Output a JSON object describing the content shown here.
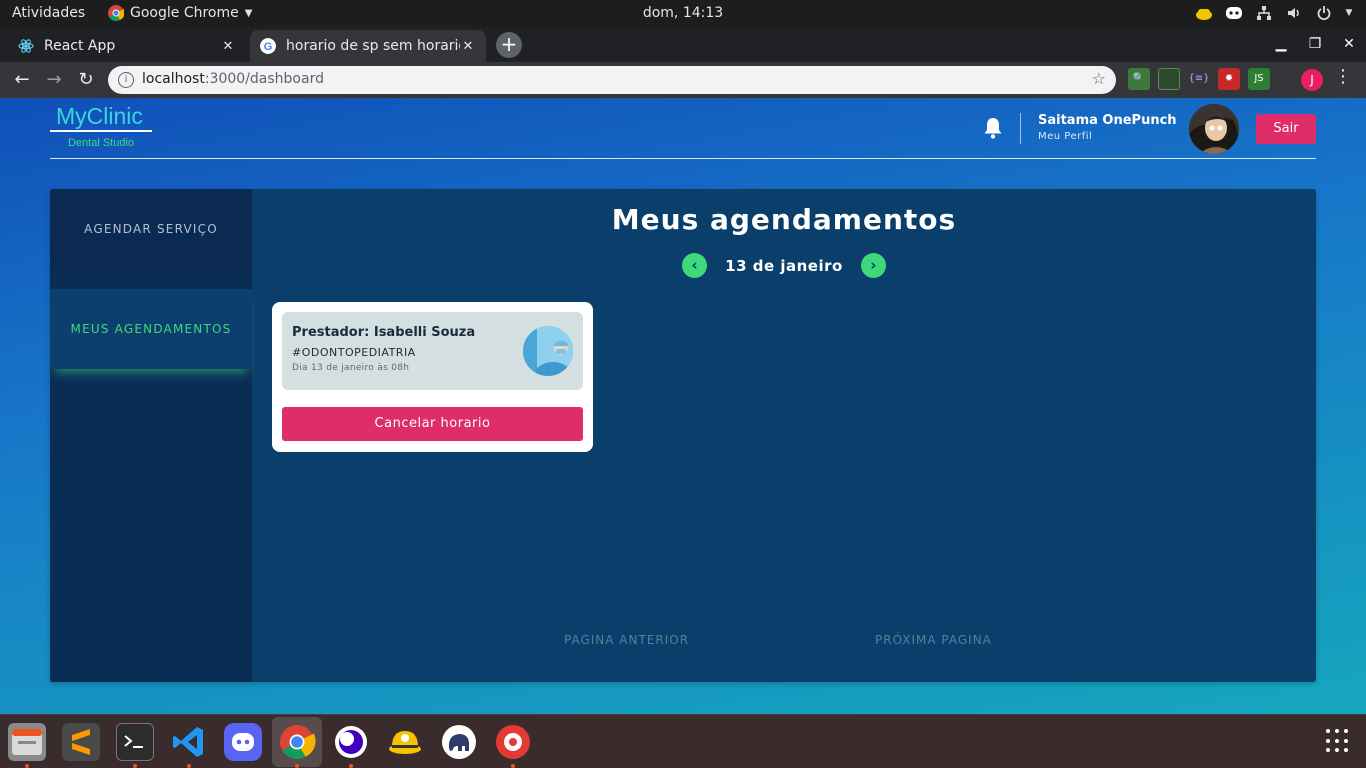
{
  "system": {
    "activities": "Atividades",
    "app_menu": "Google Chrome",
    "clock": "dom, 14:13"
  },
  "browser": {
    "tabs": [
      {
        "title": "React App",
        "active": false
      },
      {
        "title": "horario de sp sem horario",
        "active": true
      }
    ],
    "url_host": "localhost",
    "url_path": ":3000/dashboard",
    "profile_initial": "J"
  },
  "header": {
    "brand": "MyClinic",
    "brand_sub": "Dental Studio",
    "user_name": "Saitama OnePunch",
    "profile_link": "Meu Perfil",
    "logout": "Sair"
  },
  "sidebar": {
    "items": [
      {
        "label": "AGENDAR SERVIÇO",
        "active": false
      },
      {
        "label": "MEUS AGENDAMENTOS",
        "active": true
      }
    ]
  },
  "main": {
    "title": "Meus agendamentos",
    "date": "13 de janeiro",
    "appointments": [
      {
        "provider": "Prestador: Isabelli Souza",
        "service": "#ODONTOPEDIATRIA",
        "when": "Dia 13 de janeiro às 08h",
        "cancel_label": "Cancelar horario"
      }
    ],
    "pagination": {
      "prev": "PAGINA ANTERIOR",
      "next": "PRÓXIMA PAGINA"
    }
  },
  "colors": {
    "accent_green": "#3ed87d",
    "accent_pink": "#de2d68",
    "brand_cyan": "#3ed3e0"
  }
}
